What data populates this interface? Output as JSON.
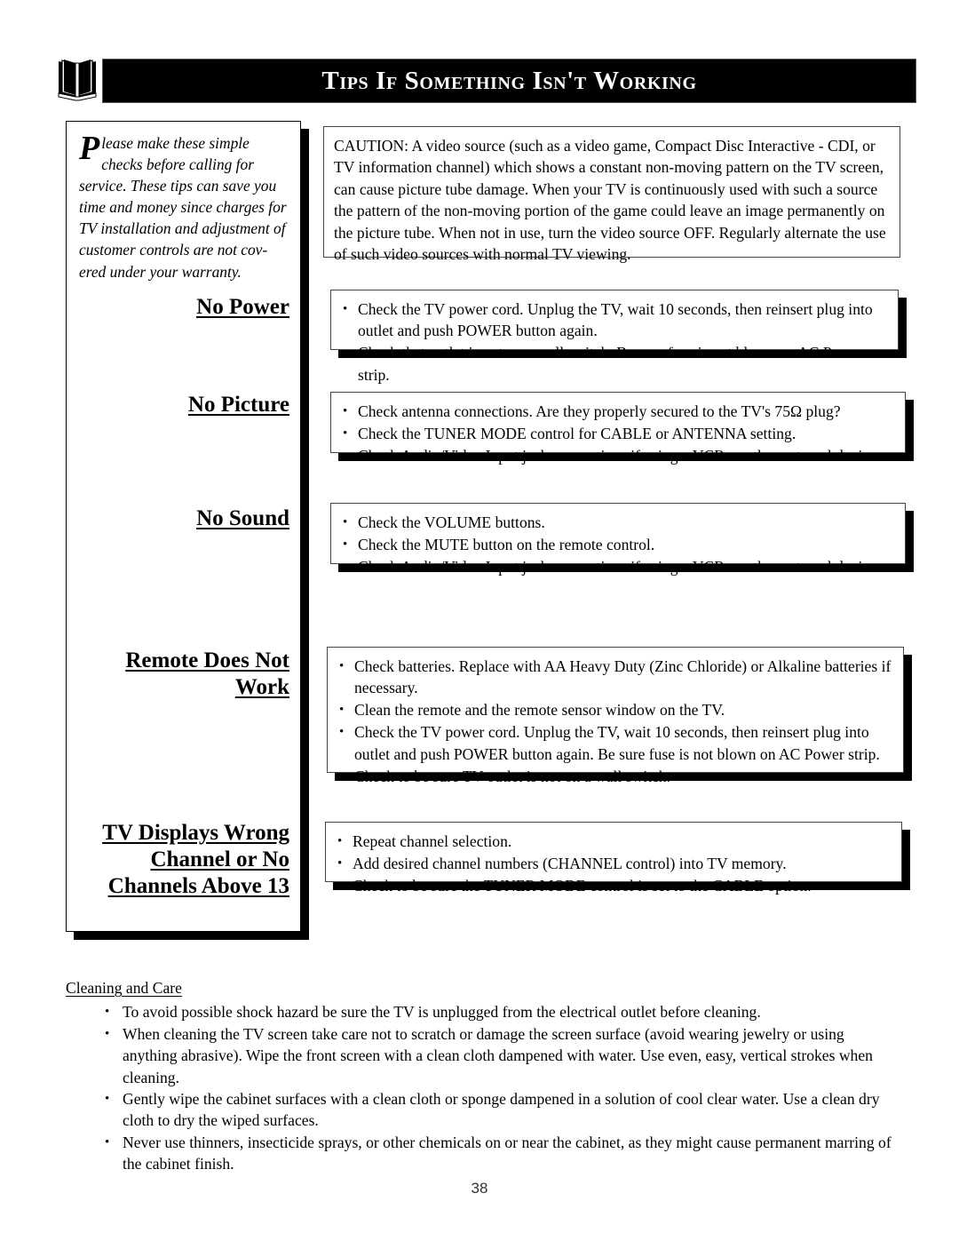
{
  "header": {
    "icon": "open-book-icon",
    "title": "Tips If Something Isn't Working"
  },
  "intro": {
    "dropcap": "P",
    "text": "lease make these simple checks before calling for service. These tips can save you time and money since charges for TV installation and adjustment of customer controls are not cov-ered under your warranty."
  },
  "caution": {
    "text": "CAUTION: A video source (such as a video game, Compact Disc Interactive - CDI, or TV information channel) which shows a constant non-moving pattern on the TV screen, can cause picture tube damage.  When your TV is continuously used with such a source the pattern of the non-moving portion of the game could leave an image permanently on the picture tube.  When not in use, turn the video source OFF.  Regularly alternate the use of such video sources with normal TV viewing."
  },
  "sections": [
    {
      "heading": "No Power",
      "bullets": [
        "Check the TV power cord.  Unplug the TV, wait 10 seconds, then reinsert plug into outlet and push POWER button again.",
        "Check that outlet is not on a wall switch. Be sure fuse is not blown on AC Power strip."
      ]
    },
    {
      "heading": "No Picture",
      "bullets": [
        "Check antenna connections.  Are they properly secured to the TV's 75Ω plug?",
        "Check the TUNER MODE control for CABLE or ANTENNA setting.",
        "Check Audio/Video Input jack connections if using a VCR or other external device."
      ]
    },
    {
      "heading": "No Sound",
      "bullets": [
        "Check the VOLUME buttons.",
        "Check the MUTE button on the remote control.",
        "Check Audio/Video Input jack connections if using a VCR or other external device."
      ]
    },
    {
      "heading": "Remote Does Not Work",
      "heading_line1": "Remote Does Not",
      "heading_line2": "Work",
      "bullets": [
        "Check batteries.  Replace with AA Heavy Duty (Zinc Chloride) or Alkaline batteries if necessary.",
        "Clean the remote and the remote sensor window on the TV.",
        "Check the TV power cord.  Unplug the TV, wait 10 seconds, then reinsert plug into outlet and push POWER button again. Be sure fuse is not blown on AC Power strip.",
        "Check to be sure TV outlet is not on a wall switch."
      ]
    },
    {
      "heading": "TV Displays Wrong Channel or No Channels Above 13",
      "heading_line1": "TV Displays Wrong",
      "heading_line2": "Channel or No",
      "heading_line3": "Channels Above 13",
      "bullets": [
        "Repeat channel selection.",
        "Add desired channel numbers (CHANNEL control) into TV memory.",
        "Check to be sure the TUNER MODE control is set to the CABLE option."
      ]
    }
  ],
  "cleaning": {
    "title": "Cleaning and Care",
    "bullets": [
      "To avoid possible shock hazard be sure the TV is unplugged from the electrical outlet before cleaning.",
      "When cleaning the TV screen take care not to scratch or damage the screen surface (avoid wearing jewelry or using anything abrasive). Wipe the front screen with a clean cloth dampened with water. Use even, easy, vertical strokes when cleaning.",
      "Gently wipe the cabinet surfaces with a clean cloth or sponge dampened in a solution of cool clear water. Use a clean dry cloth to dry the wiped surfaces.",
      "Never use thinners, insecticide sprays, or other chemicals on or near the cabinet, as they might cause permanent marring of the cabinet finish."
    ]
  },
  "footer": {
    "page_number": "38"
  },
  "colors": {
    "header_bar": "#000000",
    "header_text": "#ffffff",
    "body_text": "#000000",
    "shadow": "#000000",
    "page_background": "#ffffff"
  }
}
